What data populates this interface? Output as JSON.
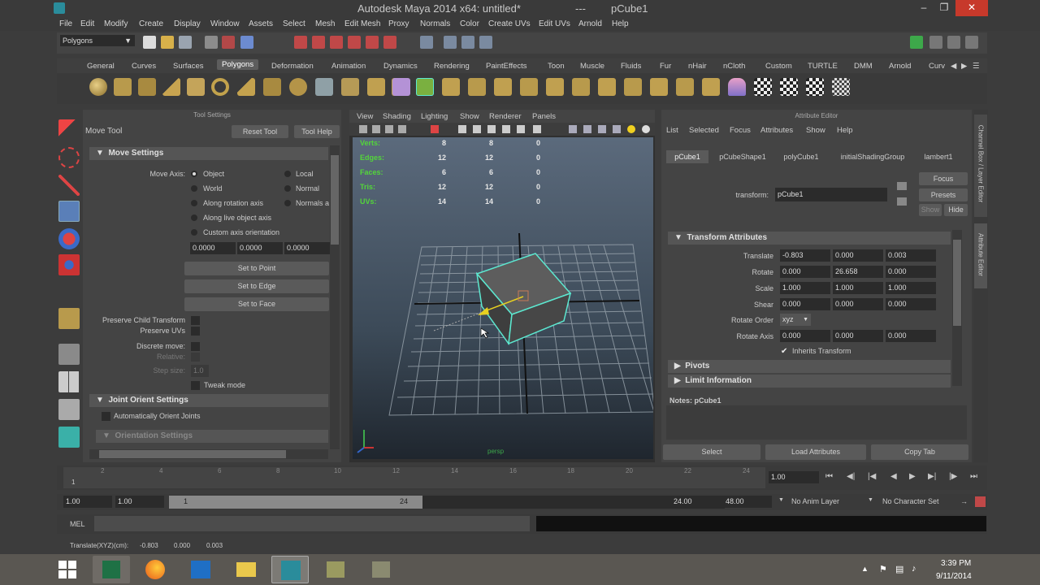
{
  "window": {
    "title": "Autodesk Maya 2014 x64: untitled*",
    "separator": "---",
    "object": "pCube1"
  },
  "menubar": [
    "File",
    "Edit",
    "Modify",
    "Create",
    "Display",
    "Window",
    "Assets",
    "Select",
    "Mesh",
    "Edit Mesh",
    "Proxy",
    "Normals",
    "Color",
    "Create UVs",
    "Edit UVs",
    "Arnold",
    "Help"
  ],
  "statusline": {
    "mode": "Polygons"
  },
  "shelf_tabs": [
    "General",
    "Curves",
    "Surfaces",
    "Polygons",
    "Deformation",
    "Animation",
    "Dynamics",
    "Rendering",
    "PaintEffects",
    "Toon",
    "Muscle",
    "Fluids",
    "Fur",
    "nHair",
    "nCloth",
    "Custom",
    "TURTLE",
    "DMM",
    "Arnold",
    "Curv"
  ],
  "shelf_icons": [
    "sphere",
    "cube",
    "cylinder",
    "cone",
    "plane",
    "torus",
    "prism",
    "pipe",
    "helix",
    "soccer-ball",
    "platonic",
    "combine",
    "separate",
    "extract",
    "smooth",
    "boolean",
    "mirror",
    "bevel",
    "bridge",
    "extrude",
    "append",
    "fill-hole",
    "split",
    "insert-loop",
    "offset-loop",
    "slide",
    "merge",
    "wedge",
    "poke",
    "cut",
    "checker",
    "uv-layout",
    "uv-unfold",
    "uv-snapshot"
  ],
  "tool_settings": {
    "header": "Tool Settings",
    "tool_name": "Move Tool",
    "reset_btn": "Reset Tool",
    "help_btn": "Tool Help",
    "move_settings": "Move Settings",
    "move_axis_label": "Move Axis:",
    "axis_options": [
      "Object",
      "Local",
      "World",
      "Normal",
      "Along rotation axis",
      "Normals a",
      "Along live object axis",
      "Custom axis orientation"
    ],
    "vals": [
      "0.0000",
      "0.0000",
      "0.0000"
    ],
    "set_point": "Set to Point",
    "set_edge": "Set to Edge",
    "set_face": "Set to Face",
    "preserve_child": "Preserve Child Transform",
    "preserve_uvs": "Preserve UVs",
    "discrete_move": "Discrete move:",
    "relative": "Relative:",
    "step_size": "Step size:",
    "step_val": "1.0",
    "tweak_mode": "Tweak mode",
    "joint_orient": "Joint Orient Settings",
    "auto_orient": "Automatically Orient Joints",
    "orientation": "Orientation Settings"
  },
  "viewport": {
    "menu": [
      "View",
      "Shading",
      "Lighting",
      "Show",
      "Renderer",
      "Panels"
    ],
    "hud": [
      {
        "label": "Verts:",
        "v": [
          "8",
          "8",
          "0"
        ]
      },
      {
        "label": "Edges:",
        "v": [
          "12",
          "12",
          "0"
        ]
      },
      {
        "label": "Faces:",
        "v": [
          "6",
          "6",
          "0"
        ]
      },
      {
        "label": "Tris:",
        "v": [
          "12",
          "12",
          "0"
        ]
      },
      {
        "label": "UVs:",
        "v": [
          "14",
          "14",
          "0"
        ]
      }
    ],
    "camera": "persp"
  },
  "attribute_editor": {
    "header": "Attribute Editor",
    "menu": [
      "List",
      "Selected",
      "Focus",
      "Attributes",
      "Show",
      "Help"
    ],
    "tabs": [
      "pCube1",
      "pCubeShape1",
      "polyCube1",
      "initialShadingGroup",
      "lambert1"
    ],
    "transform_label": "transform:",
    "transform_value": "pCube1",
    "focus": "Focus",
    "presets": "Presets",
    "show": "Show",
    "hide": "Hide",
    "transform_attrs": "Transform Attributes",
    "translate_label": "Translate",
    "translate": [
      "-0.803",
      "0.000",
      "0.003"
    ],
    "rotate_label": "Rotate",
    "rotate": [
      "0.000",
      "26.658",
      "0.000"
    ],
    "scale_label": "Scale",
    "scale": [
      "1.000",
      "1.000",
      "1.000"
    ],
    "shear_label": "Shear",
    "shear": [
      "0.000",
      "0.000",
      "0.000"
    ],
    "rotate_order_label": "Rotate Order",
    "rotate_order": "xyz",
    "rotate_axis_label": "Rotate Axis",
    "rotate_axis": [
      "0.000",
      "0.000",
      "0.000"
    ],
    "inherits": "Inherits Transform",
    "pivots": "Pivots",
    "limit": "Limit Information",
    "notes": "Notes: pCube1",
    "select": "Select",
    "load_attrs": "Load Attributes",
    "copy_tab": "Copy Tab"
  },
  "side_strip": {
    "top": "Channel Box / Layer Editor",
    "bottom": "Attribute Editor"
  },
  "timeline": {
    "ticks": [
      "1",
      "2",
      "4",
      "6",
      "8",
      "10",
      "12",
      "14",
      "16",
      "18",
      "20",
      "22",
      "24"
    ],
    "current": "1.00"
  },
  "range": {
    "start": "1.00",
    "start2": "1.00",
    "slider_start": "1",
    "slider_end": "24",
    "end": "24.00",
    "end2": "48.00",
    "anim_layer": "No Anim Layer",
    "char_set": "No Character Set"
  },
  "mel": {
    "label": "MEL"
  },
  "helpline": {
    "text": "Translate(XYZ)(cm):",
    "values": [
      "-0.803",
      "0.000",
      "0.003"
    ]
  },
  "taskbar": {
    "time": "3:39 PM",
    "date": "9/11/2014"
  },
  "colors": {
    "accent_green": "#53d63a",
    "selection": "#5ce8d0",
    "maya_bg": "#444444"
  }
}
